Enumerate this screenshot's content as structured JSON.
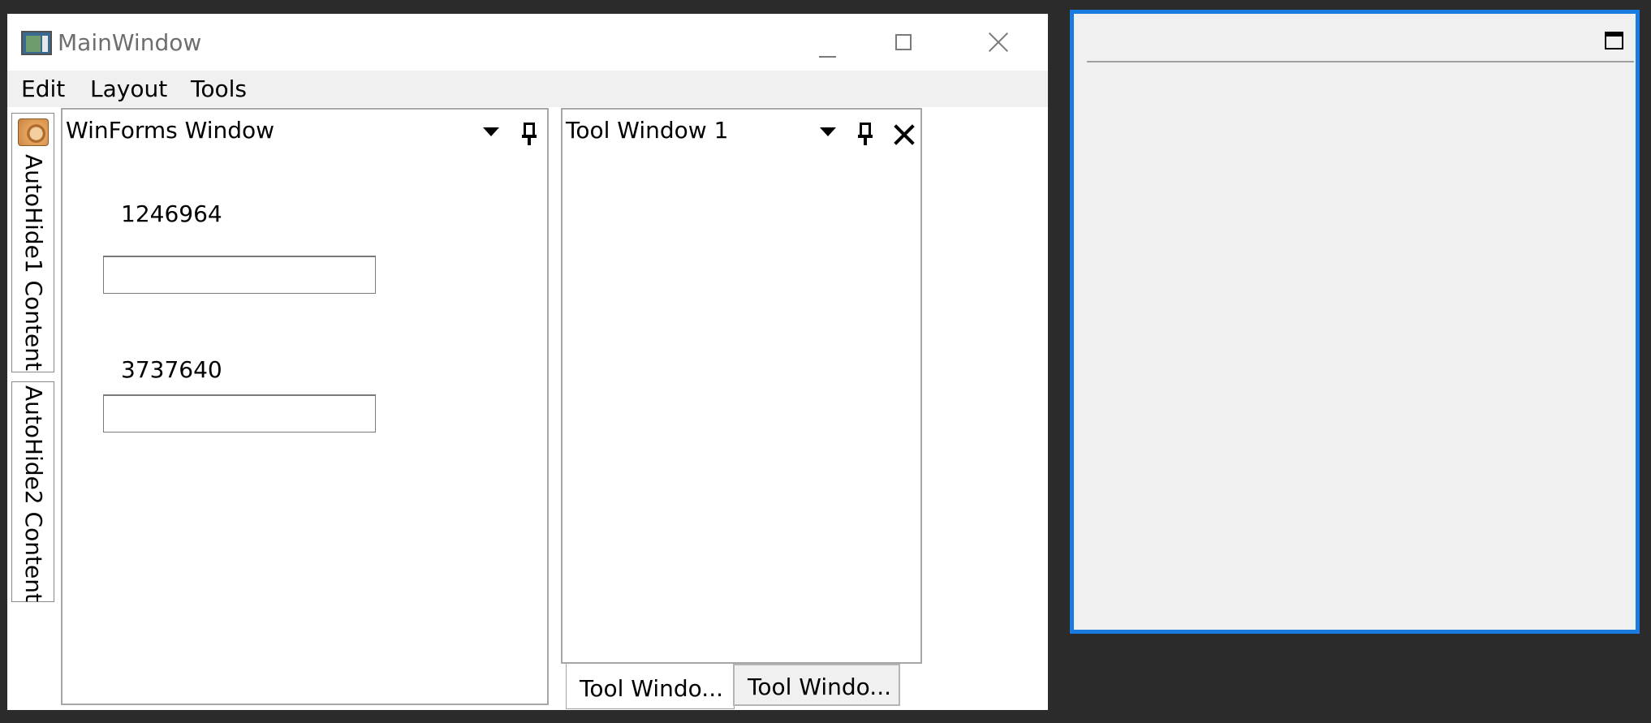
{
  "main_window": {
    "title": "MainWindow",
    "menu": [
      "Edit",
      "Layout",
      "Tools"
    ]
  },
  "auto_hide_tabs": [
    "AutoHide1 Content",
    "AutoHide2 Content"
  ],
  "winforms_pane": {
    "title": "WinForms Window",
    "fields": [
      {
        "label": "1246964",
        "value": ""
      },
      {
        "label": "3737640",
        "value": ""
      }
    ]
  },
  "tool_pane": {
    "title": "Tool Window 1",
    "tabs": [
      {
        "label": "Tool Windo...",
        "active": true
      },
      {
        "label": "Tool Windo...",
        "active": false
      }
    ]
  },
  "icons": {
    "app": "app-window-icon",
    "minimize": "minimize-icon",
    "maximize": "maximize-icon",
    "close": "close-icon",
    "dropdown": "dropdown-icon",
    "pin": "pin-icon",
    "autohide": "autohide-content-icon"
  },
  "colors": {
    "floating_border": "#1a7ce0",
    "desktop": "#2b2b2b",
    "menubar": "#f0f0f0"
  }
}
